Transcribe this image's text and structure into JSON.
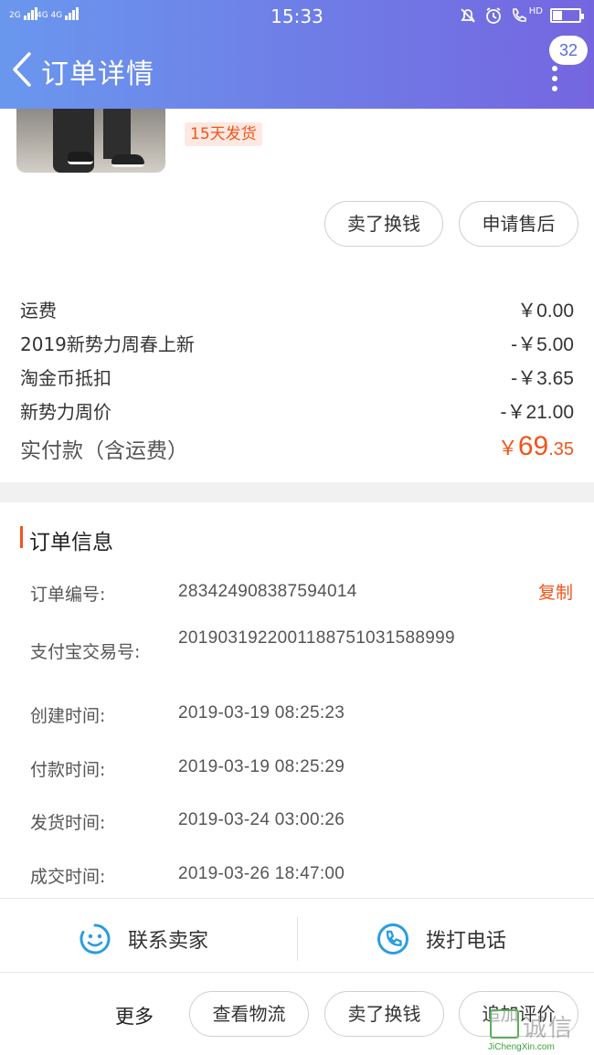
{
  "status_bar": {
    "sim1": "2G",
    "sim2": "4G 4G",
    "time": "15:33",
    "hd": "HD",
    "battery_level": 0.35
  },
  "header": {
    "title": "订单详情",
    "badge": "32"
  },
  "product": {
    "shipping_tag": "15天发货"
  },
  "item_actions": {
    "sell": "卖了换钱",
    "after_sale": "申请售后"
  },
  "fees": [
    {
      "label": "运费",
      "value": "￥0.00"
    },
    {
      "label": "2019新势力周春上新",
      "value": "-￥5.00"
    },
    {
      "label": "淘金币抵扣",
      "value": "-￥3.65"
    },
    {
      "label": "新势力周价",
      "value": "-￥21.00"
    }
  ],
  "total": {
    "label": "实付款（含运费）",
    "currency": "￥",
    "integer": "69",
    "decimal": ".35",
    "color": "#f2541b"
  },
  "order_info": {
    "section_title": "订单信息",
    "copy_label": "复制",
    "rows": [
      {
        "label": "订单编号:",
        "value": "283424908387594014"
      },
      {
        "label": "支付宝交易号:",
        "value": "2019031922001188751031588999"
      },
      {
        "label": "创建时间:",
        "value": "2019-03-19 08:25:23"
      },
      {
        "label": "付款时间:",
        "value": "2019-03-19 08:25:29"
      },
      {
        "label": "发货时间:",
        "value": "2019-03-24 03:00:26"
      },
      {
        "label": "成交时间:",
        "value": "2019-03-26 18:47:00"
      }
    ]
  },
  "contact": {
    "seller": "联系卖家",
    "call": "拨打电话",
    "icon_seller": "chat-smile-icon",
    "icon_call": "phone-icon"
  },
  "bottom_actions": {
    "more": "更多",
    "logistics": "查看物流",
    "sell": "卖了换钱",
    "review": "追加评价"
  },
  "watermark": {
    "text": "诚信",
    "url": "JiChengXin.com"
  },
  "colors": {
    "accent": "#f2541b",
    "header_start": "#6a97ee",
    "header_end": "#7566e0",
    "icon_blue": "#2a9de0"
  }
}
